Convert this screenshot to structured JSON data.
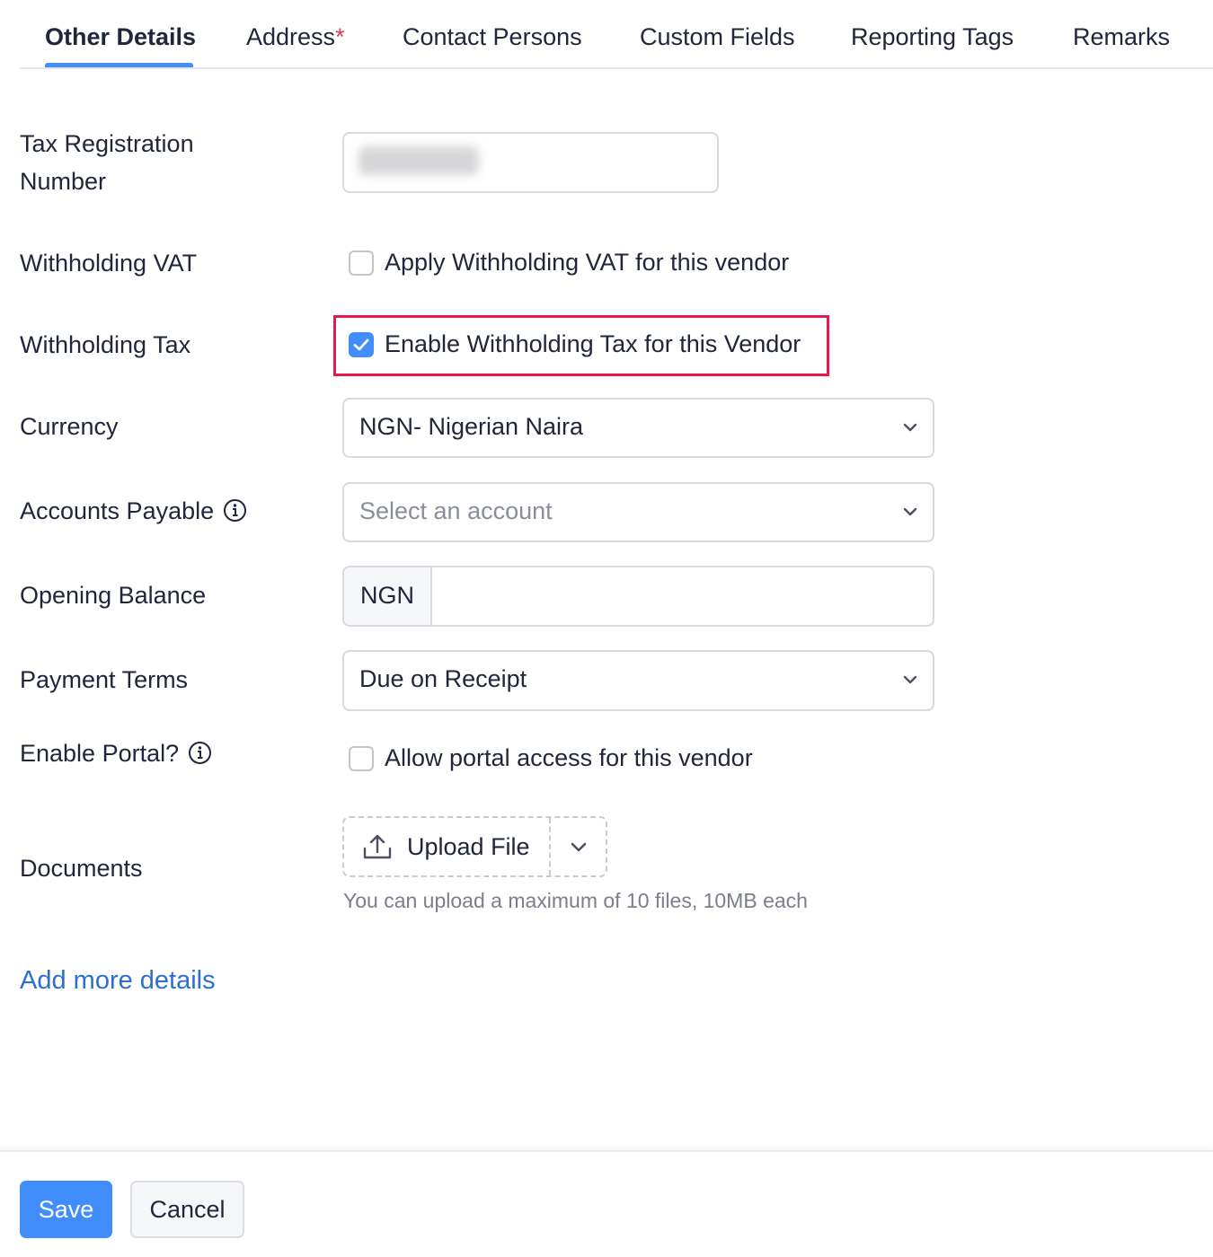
{
  "tabs": [
    {
      "label": "Other Details",
      "active": true
    },
    {
      "label": "Address",
      "required_mark": "*"
    },
    {
      "label": "Contact Persons"
    },
    {
      "label": "Custom Fields"
    },
    {
      "label": "Reporting Tags"
    },
    {
      "label": "Remarks"
    }
  ],
  "form": {
    "tax_registration": {
      "label_line1": "Tax Registration",
      "label_line2": "Number",
      "value": ""
    },
    "withholding_vat": {
      "label": "Withholding VAT",
      "checkbox_label": "Apply Withholding VAT for this vendor",
      "checked": false
    },
    "withholding_tax": {
      "label": "Withholding Tax",
      "checkbox_label": "Enable Withholding Tax for this Vendor",
      "checked": true
    },
    "currency": {
      "label": "Currency",
      "value": "NGN- Nigerian Naira"
    },
    "accounts_payable": {
      "label": "Accounts Payable",
      "placeholder": "Select an account"
    },
    "opening_balance": {
      "label": "Opening Balance",
      "currency_prefix": "NGN",
      "value": ""
    },
    "payment_terms": {
      "label": "Payment Terms",
      "value": "Due on Receipt"
    },
    "enable_portal": {
      "label": "Enable Portal?",
      "checkbox_label": "Allow portal access for this vendor",
      "checked": false
    },
    "documents": {
      "label": "Documents",
      "upload_label": "Upload File",
      "hint": "You can upload a maximum of 10 files, 10MB each"
    }
  },
  "add_more_details": "Add more details",
  "footer": {
    "save_label": "Save",
    "cancel_label": "Cancel"
  },
  "colors": {
    "accent": "#408dfb",
    "highlight": "#e8184d",
    "link": "#2d6ed6",
    "required": "#e8364f"
  }
}
